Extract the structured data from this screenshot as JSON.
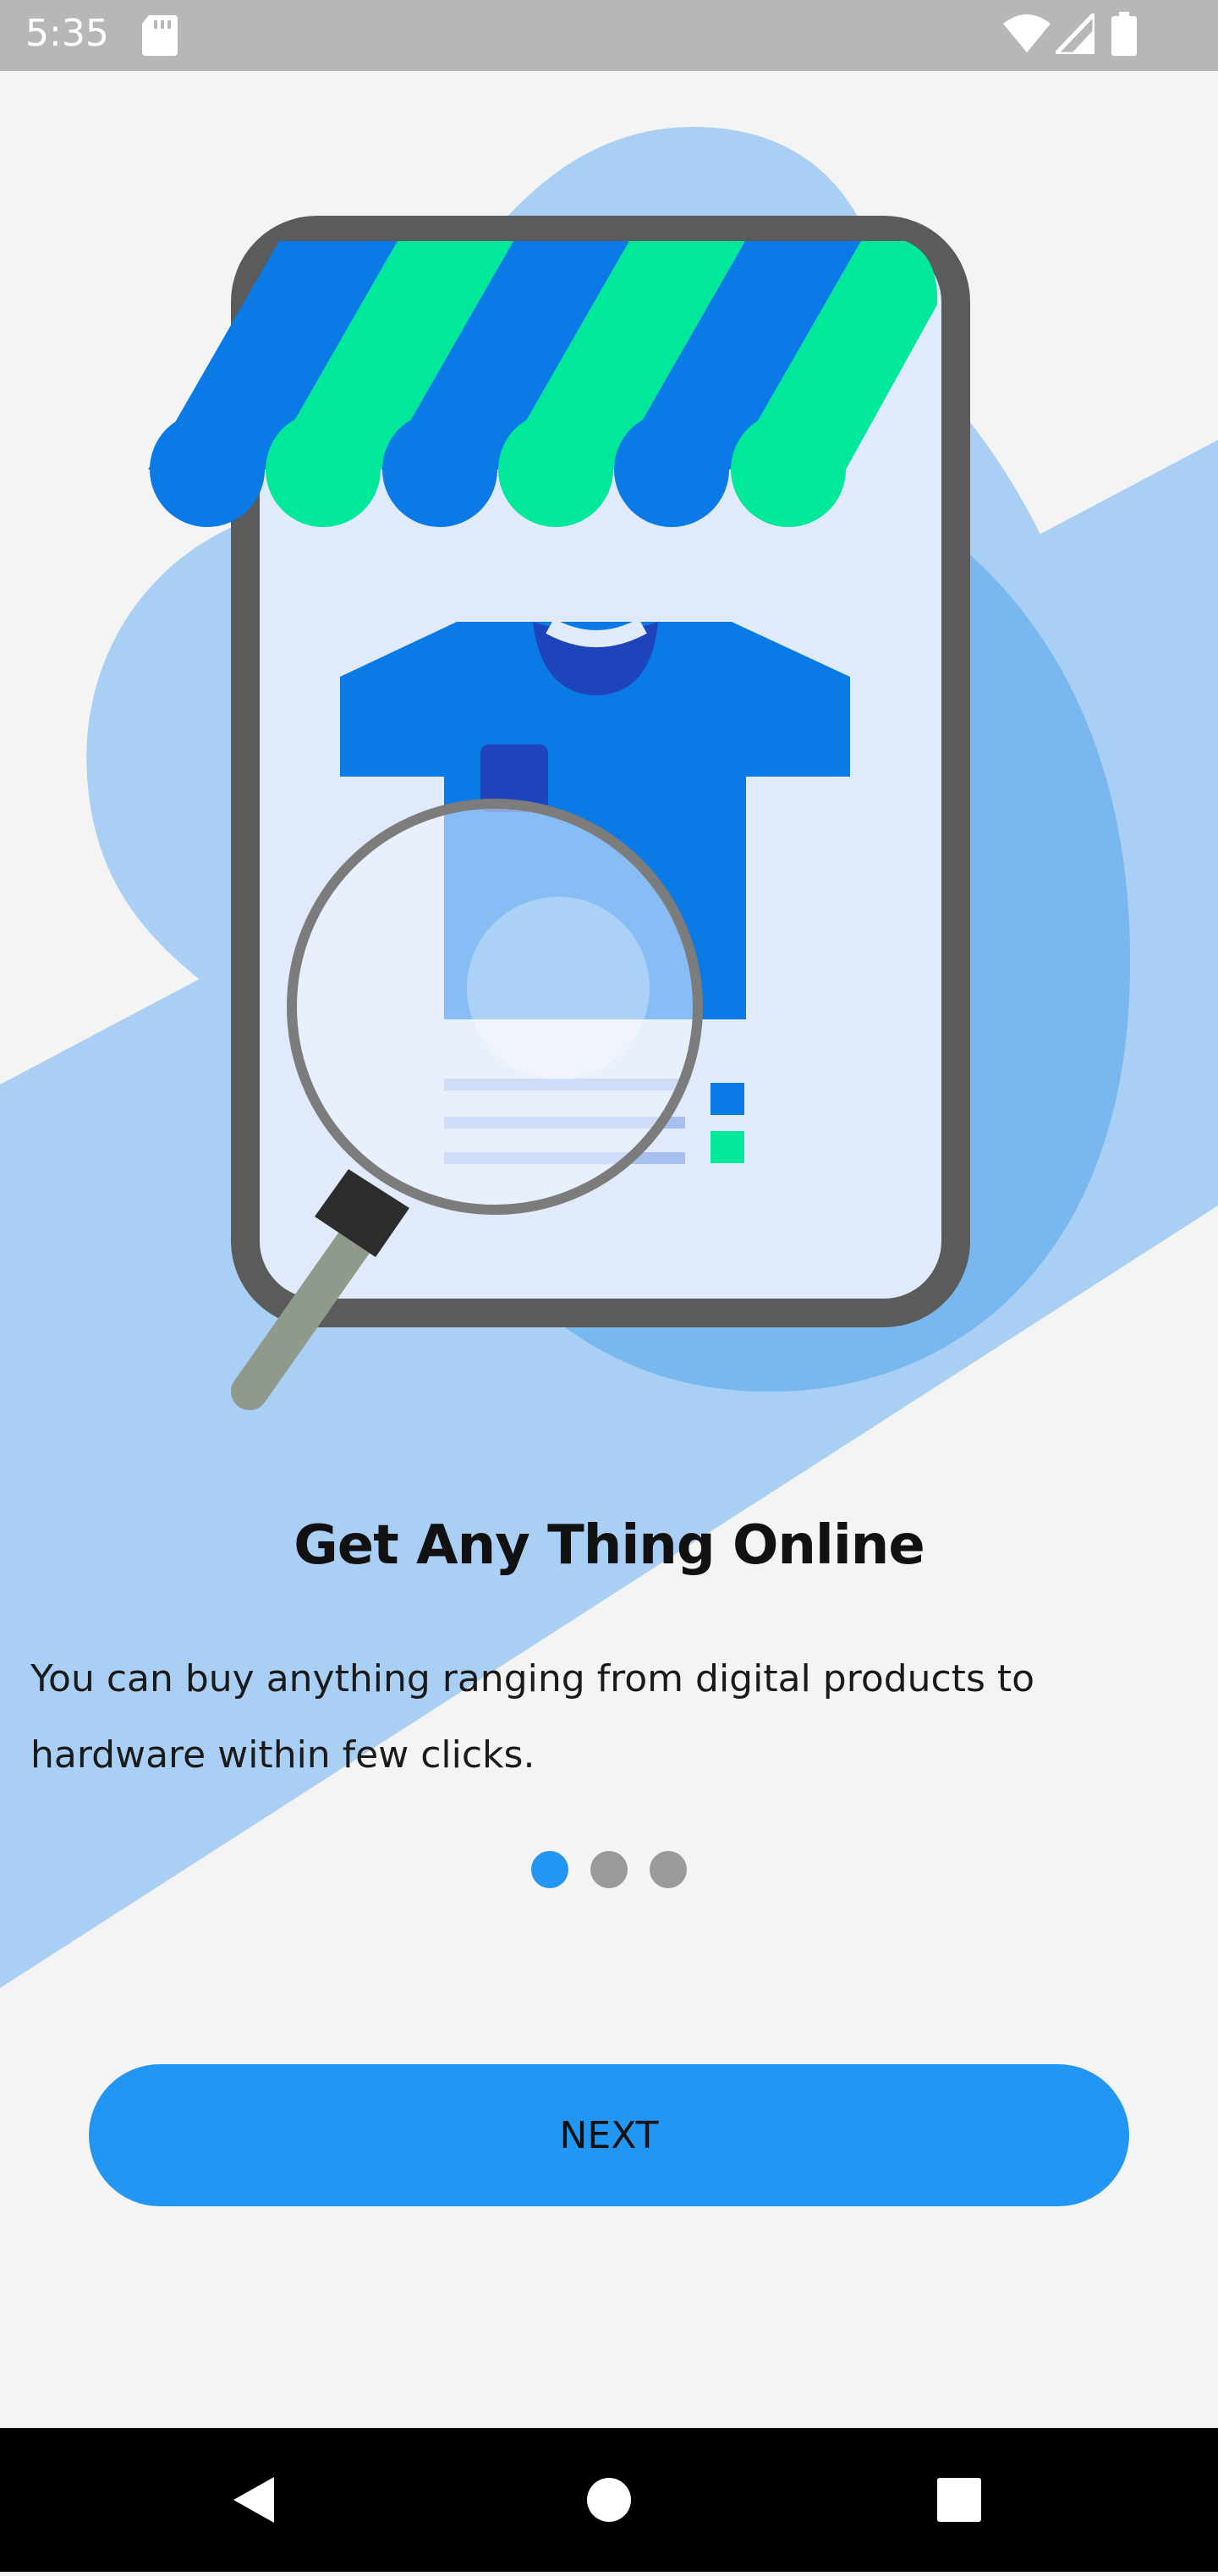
{
  "status_bar": {
    "time": "5:35",
    "icons": [
      "sd-card-icon",
      "wifi-icon",
      "cellular-signal-icon",
      "battery-icon"
    ]
  },
  "onboarding": {
    "title": "Get Any Thing Online",
    "description": "You can buy anything ranging from digital products to hardware within few clicks.",
    "page_indicator": {
      "total": 3,
      "active": 1
    },
    "next_label": "NEXT"
  },
  "nav_bar": {
    "icons": [
      "back-icon",
      "home-icon",
      "recents-icon"
    ]
  },
  "colors": {
    "accent": "#2196f3",
    "awning_blue": "#0a7ae6",
    "awning_green": "#00e89a",
    "background": "#f4f4f4",
    "band": "#aacff4"
  }
}
